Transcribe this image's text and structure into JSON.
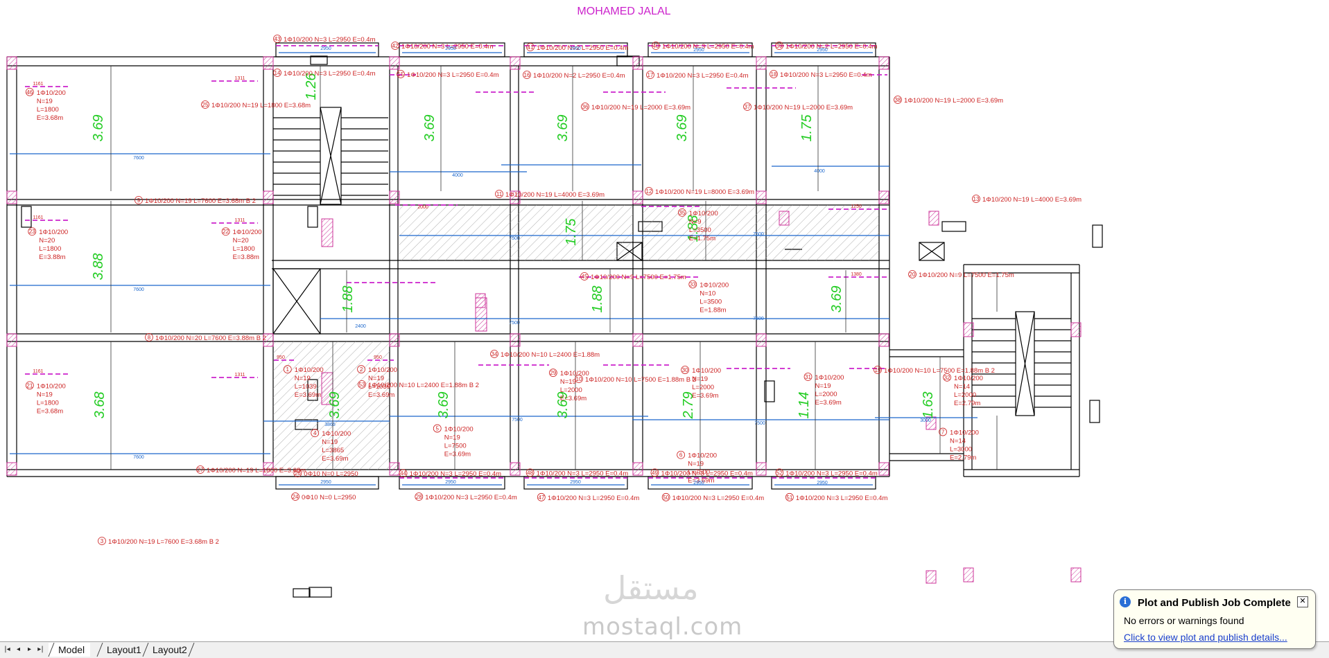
{
  "drawing": {
    "title": "MOHAMED JALAL",
    "span_dimensions": [
      "3.69",
      "3.88",
      "3.68",
      "1.26",
      "3.69",
      "3.69",
      "3.69",
      "1.75",
      "1.75",
      "1.88",
      "1.88",
      "1.88",
      "3.69",
      "3.69",
      "3.69",
      "3.69",
      "2.79",
      "1.14",
      "1.63"
    ],
    "bar_labels_top": [
      {
        "id": "43",
        "text": "1Φ10/200  N=3  L=2950  E=0.4m"
      },
      {
        "id": "42",
        "text": "1Φ10/200  N=3  L=2950  E=0.4m"
      },
      {
        "id": "41",
        "text": "1Φ10/200  N=2  L=2950  E=0.4m"
      },
      {
        "id": "40",
        "text": "1Φ10/200  N=3  L=2950  E=0.4m"
      },
      {
        "id": "39",
        "text": "1Φ10/200  N=2  L=2950  E=0.4m"
      },
      {
        "id": "14",
        "text": "1Φ10/200  N=3  L=2950  E=0.4m"
      },
      {
        "id": "15",
        "text": "1Φ10/200  N=3  L=2950  E=0.4m"
      },
      {
        "id": "16",
        "text": "1Φ10/200  N=2  L=2950  E=0.4m"
      },
      {
        "id": "17",
        "text": "1Φ10/200  N=3  L=2950  E=0.4m"
      },
      {
        "id": "18",
        "text": "1Φ10/200  N=3  L=2950  E=0.4m"
      }
    ],
    "bar_labels_main": [
      {
        "id": "25",
        "text": "1Φ10/200  N=19  L=1800  E=3.68m"
      },
      {
        "id": "9",
        "text": "1Φ10/200  N=19  L=7600  E=3.68m   B 2"
      },
      {
        "id": "36",
        "text": "1Φ10/200  N=19  L=2000  E=3.69m"
      },
      {
        "id": "37",
        "text": "1Φ10/200  N=19  L=2000  E=3.69m"
      },
      {
        "id": "38",
        "text": "1Φ10/200  N=19  L=2000  E=3.69m"
      },
      {
        "id": "11",
        "text": "1Φ10/200  N=19  L=4000  E=3.69m"
      },
      {
        "id": "12",
        "text": "1Φ10/200  N=19  L=8000  E=3.69m"
      },
      {
        "id": "13",
        "text": "1Φ10/200  N=19  L=4000  E=3.69m"
      },
      {
        "id": "45",
        "text": "1Φ10/200  N=9  L=7500  E=1.75m"
      },
      {
        "id": "20",
        "text": "1Φ10/200  N=9  L=7500  E=1.75m"
      },
      {
        "id": "8",
        "text": "1Φ10/200  N=20  L=7600  E=3.88m   B 2"
      },
      {
        "id": "34",
        "text": "1Φ10/200  N=10  L=2400  E=1.88m"
      },
      {
        "id": "53",
        "text": "1Φ10/200  N=10  L=2400  E=1.88m  B 2"
      },
      {
        "id": "10",
        "text": "1Φ10/200  N=10  L=7500  E=1.88m   B 2"
      },
      {
        "id": "19",
        "text": "1Φ10/200  N=10  L=7500  E=1.88m   B 2"
      },
      {
        "id": "27",
        "text": "1Φ10/200  N=19  L=1800  E=3.68m"
      },
      {
        "id": "3",
        "text": "1Φ10/200  N=19  L=7600  E=3.68m   B 2"
      }
    ],
    "bar_blocks": [
      {
        "id": "46",
        "lines": [
          "1Φ10/200",
          "N=19",
          "L=1800",
          "E=3.68m"
        ]
      },
      {
        "id": "23",
        "lines": [
          "1Φ10/200",
          "N=20",
          "L=1800",
          "E=3.88m"
        ]
      },
      {
        "id": "22",
        "lines": [
          "1Φ10/200",
          "N=20",
          "L=1800",
          "E=3.88m"
        ]
      },
      {
        "id": "21",
        "lines": [
          "1Φ10/200",
          "N=19",
          "L=1800",
          "E=3.68m"
        ]
      },
      {
        "id": "35",
        "lines": [
          "1Φ10/200",
          "N=9",
          "L=3500",
          "E=1.75m"
        ]
      },
      {
        "id": "33",
        "lines": [
          "1Φ10/200",
          "N=10",
          "L=3500",
          "E=1.88m"
        ]
      },
      {
        "id": "1",
        "lines": [
          "1Φ10/200",
          "N=19",
          "L=1039",
          "E=3.69m"
        ]
      },
      {
        "id": "2",
        "lines": [
          "1Φ10/200",
          "N=19",
          "L=1039",
          "E=3.69m"
        ]
      },
      {
        "id": "4",
        "lines": [
          "1Φ10/200",
          "N=19",
          "L=3865",
          "E=3.69m"
        ]
      },
      {
        "id": "5",
        "lines": [
          "1Φ10/200",
          "N=19",
          "L=7500",
          "E=3.69m"
        ]
      },
      {
        "id": "29",
        "lines": [
          "1Φ10/200",
          "N=19",
          "L=2000",
          "E=3.69m"
        ]
      },
      {
        "id": "30",
        "lines": [
          "1Φ10/200",
          "N=19",
          "L=2000",
          "E=3.69m"
        ]
      },
      {
        "id": "6",
        "lines": [
          "1Φ10/200",
          "N=19",
          "L=7500",
          "E=3.69m"
        ]
      },
      {
        "id": "31",
        "lines": [
          "1Φ10/200",
          "N=19",
          "L=2000",
          "E=3.69m"
        ]
      },
      {
        "id": "32",
        "lines": [
          "1Φ10/200",
          "N=14",
          "L=2000",
          "E=2.79m"
        ]
      },
      {
        "id": "7",
        "lines": [
          "1Φ10/200",
          "N=14",
          "L=3000",
          "E=2.79m"
        ]
      }
    ],
    "bar_labels_bottom": [
      {
        "id": "26",
        "text": "0Φ10  N=0  L=2950"
      },
      {
        "id": "44",
        "text": "1Φ10/200  N=3  L=2950  E=0.4m"
      },
      {
        "id": "48",
        "text": "1Φ10/200  N=3  L=2950  E=0.4m"
      },
      {
        "id": "49",
        "text": "1Φ10/200  N=3  L=2950  E=0.4m"
      },
      {
        "id": "52",
        "text": "1Φ10/200  N=3  L=2950  E=0.4m"
      },
      {
        "id": "24",
        "text": "0Φ10  N=0  L=2950"
      },
      {
        "id": "28",
        "text": "1Φ10/200  N=3  L=2950  E=0.4m"
      },
      {
        "id": "47",
        "text": "1Φ10/200  N=3  L=2950  E=0.4m"
      },
      {
        "id": "50",
        "text": "1Φ10/200  N=3  L=2950  E=0.4m"
      },
      {
        "id": "51",
        "text": "1Φ10/200  N=3  L=2950  E=0.4m"
      }
    ],
    "small_dims": [
      "7600",
      "7600",
      "7600",
      "4000",
      "4000",
      "7500",
      "7500",
      "7500",
      "7500",
      "2400",
      "3865",
      "7500",
      "7500",
      "3000",
      "2950",
      "2950",
      "2950",
      "2950",
      "2950",
      "2950",
      "2950",
      "2950",
      "2950",
      "2950",
      "1161",
      "1311",
      "1161",
      "1311",
      "1161",
      "1311",
      "2000",
      "1250",
      "1380",
      "950",
      "950"
    ],
    "colors": {
      "wall": "#000000",
      "column_hatch": "#cc3399",
      "dimension_text": "#22cc22",
      "bar_label_text": "#cc2222",
      "bar_line_blue": "#1a66cc",
      "dashed_magenta": "#cc22cc",
      "hatch_grey": "#9a9a9a"
    }
  },
  "watermark": {
    "text": "mostaql.com",
    "mark": "مستقل"
  },
  "tabs": {
    "nav": [
      "first-icon",
      "prev-icon",
      "next-icon",
      "last-icon"
    ],
    "items": [
      "Model",
      "Layout1",
      "Layout2"
    ],
    "active": "Model"
  },
  "notification": {
    "icon": "info-icon",
    "title": "Plot and Publish Job Complete",
    "message": "No errors or warnings found",
    "link": "Click to view plot and publish details...",
    "close": "✕"
  }
}
